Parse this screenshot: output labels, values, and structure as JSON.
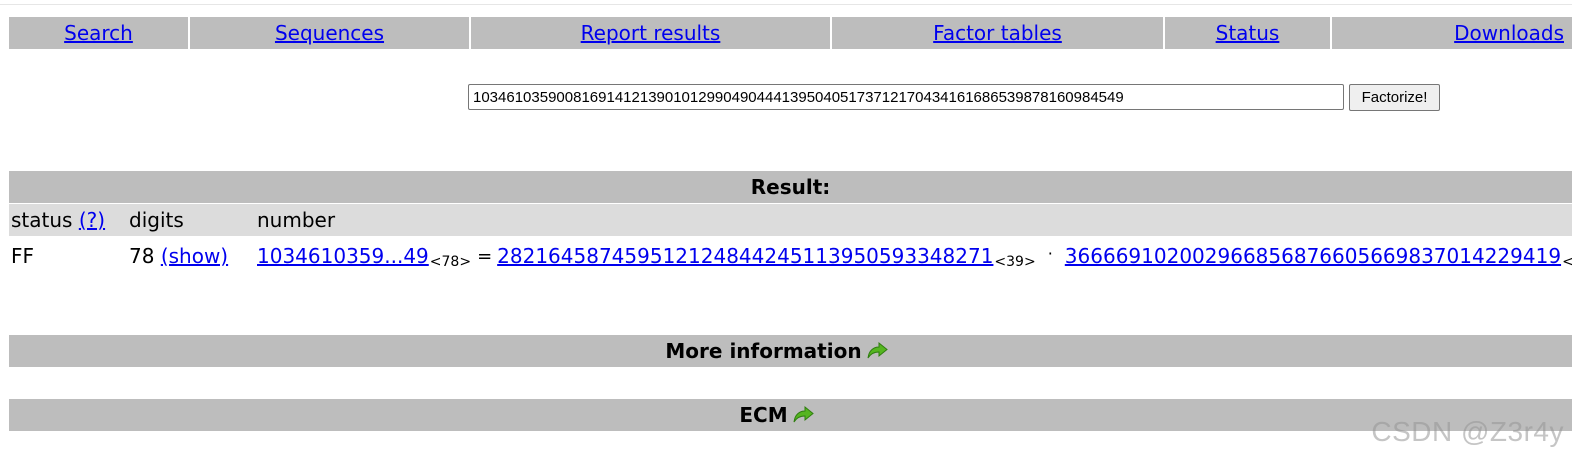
{
  "nav": {
    "items": [
      {
        "label": "Search"
      },
      {
        "label": "Sequences"
      },
      {
        "label": "Report results"
      },
      {
        "label": "Factor tables"
      },
      {
        "label": "Status"
      },
      {
        "label": "Downloads"
      }
    ]
  },
  "search": {
    "value": "103461035900816914121390101299049044413950405173712170434161686539878160984549",
    "button_label": "Factorize!"
  },
  "result": {
    "title": "Result:",
    "headers": {
      "status": "status",
      "status_help": "(?)",
      "digits": "digits",
      "number": "number"
    },
    "row": {
      "status": "FF",
      "digits": "78",
      "show_link": "(show)",
      "number_short": "1034610359...49",
      "number_digits": "<78>",
      "equals": "=",
      "factor1": "282164587459512124844245113950593348271",
      "factor1_digits": "<39>",
      "times": "·",
      "factor2": "366669102002966856876605669837014229419",
      "factor2_digits": "<39>"
    }
  },
  "sections": {
    "more_info": "More information",
    "ecm": "ECM"
  },
  "watermark": "CSDN @Z3r4y",
  "colors": {
    "bar": "#bdbdbd",
    "header_row": "#dcdcdc",
    "link": "#0000ee",
    "arrow": "#55b520"
  }
}
